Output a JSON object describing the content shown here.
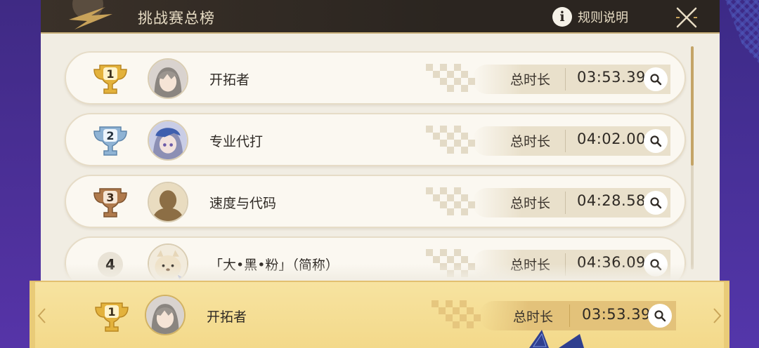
{
  "header": {
    "title": "挑战赛总榜",
    "rules_label": "规则说明"
  },
  "leaderboard": [
    {
      "rank": "1",
      "rank_icon": "gold-trophy-icon",
      "name": "开拓者",
      "time_label": "总时长",
      "time": "03:53.39"
    },
    {
      "rank": "2",
      "rank_icon": "silver-trophy-icon",
      "name": "专业代打",
      "time_label": "总时长",
      "time": "04:02.00"
    },
    {
      "rank": "3",
      "rank_icon": "bronze-trophy-icon",
      "name": "速度与代码",
      "time_label": "总时长",
      "time": "04:28.58"
    },
    {
      "rank": "4",
      "rank_icon": "rank-number-icon",
      "name": "「大•黑•粉」（简称）",
      "time_label": "总时长",
      "time": "04:36.09"
    }
  ],
  "my_rank": {
    "rank": "1",
    "rank_icon": "gold-trophy-icon",
    "name": "开拓者",
    "time_label": "总时长",
    "time": "03:53.39"
  },
  "colors": {
    "header_bg": "#2b2520",
    "panel_bg": "#f1ede3",
    "gold": "#e3b23c",
    "silver": "#8fb3d4",
    "bronze": "#b07a4c",
    "highlight_row": "#f3d98a",
    "outer_bg": "#4a2f93"
  }
}
